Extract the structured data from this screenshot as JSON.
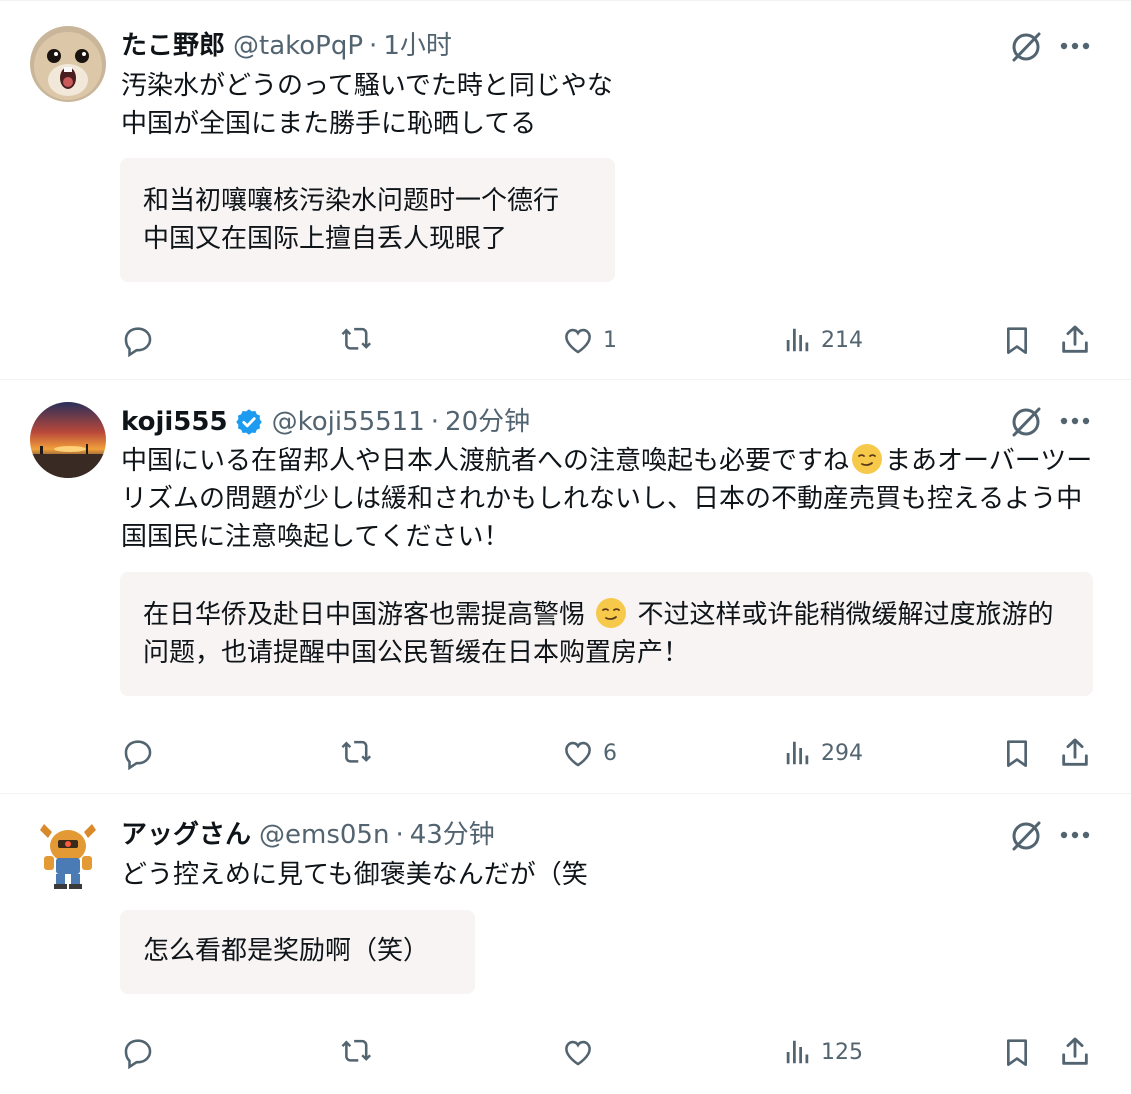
{
  "posts": [
    {
      "name": "たこ野郎",
      "handle": "@takoPqP",
      "separator": "·",
      "time": "1小时",
      "verified": false,
      "text": "汚染水がどうのって騒いでた時と同じやな\n中国が全国にまた勝手に恥晒してる",
      "translation": "和当初嚷嚷核污染水问题时一个德行\n中国又在国际上擅自丢人现眼了",
      "metrics": {
        "replies": "",
        "reposts": "",
        "likes": "1",
        "views": "214"
      },
      "avatar_icon": "hamster-avatar"
    },
    {
      "name": "koji555",
      "handle": "@koji55511",
      "separator": "·",
      "time": "20分钟",
      "verified": true,
      "text_before_emoji": "中国にいる在留邦人や日本人渡航者への注意喚起も必要ですね",
      "text_after_emoji": "まあオーバーツーリズムの問題が少しは緩和されかもしれないし、日本の不動産売買も控えるよう中国国民に注意喚起してください！",
      "translation_before_emoji": "在日华侨及赴日中国游客也需提高警惕",
      "translation_after_emoji": "不过这样或许能稍微缓解过度旅游的问题，也请提醒中国公民暂缓在日本购置房产！",
      "emoji_icon": "smirk-emoji",
      "metrics": {
        "replies": "",
        "reposts": "",
        "likes": "6",
        "views": "294"
      },
      "avatar_icon": "sunset-avatar"
    },
    {
      "name": "アッグさん",
      "handle": "@ems05n",
      "separator": "·",
      "time": "43分钟",
      "verified": false,
      "text": "どう控えめに見ても御褒美なんだが（笑",
      "translation": "怎么看都是奖励啊（笑）",
      "metrics": {
        "replies": "",
        "reposts": "",
        "likes": "",
        "views": "125"
      },
      "avatar_icon": "robot-avatar"
    }
  ],
  "colors": {
    "text": "#0f1419",
    "secondary": "#536471",
    "verified": "#1d9bf0",
    "translation_bg": "#f7f4f3",
    "divider": "#eff3f4"
  }
}
